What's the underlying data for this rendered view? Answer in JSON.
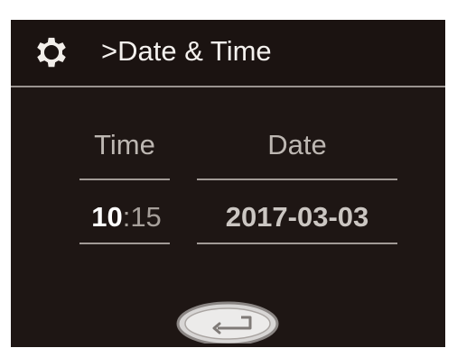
{
  "header": {
    "title": ">Date & Time",
    "icon": "gear-icon"
  },
  "columns": {
    "time_label": "Time",
    "date_label": "Date"
  },
  "values": {
    "time_hour": "10",
    "time_separator": ":",
    "time_minute": "15",
    "date": "2017-03-03"
  },
  "footer": {
    "back_icon": "return-arrow-icon"
  },
  "colors": {
    "screen_background": "#1e1614",
    "header_background": "#1b1311",
    "text_primary": "#f4f1ee",
    "text_secondary": "#bdb7b2",
    "divider": "#9a9390"
  }
}
